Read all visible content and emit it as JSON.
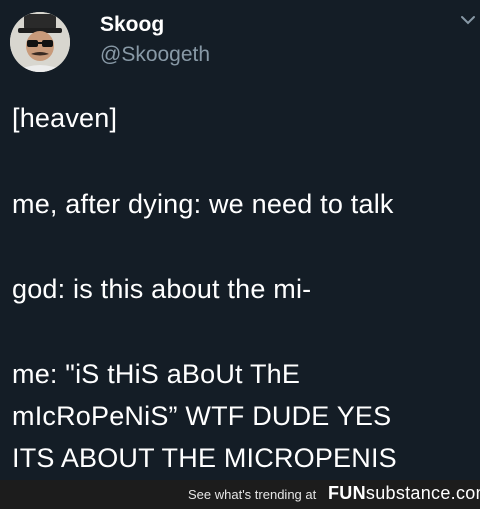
{
  "tweet": {
    "author_name": "Skoog",
    "author_handle": "@Skoogeth",
    "lines": [
      "[heaven]",
      "me, after dying: we need to talk",
      "god: is this about the mi-",
      "me: \"iS tHiS aBoUt ThE",
      "mIcRoPeNiS” WTF DUDE YES",
      "ITS ABOUT THE MICROPENIS"
    ]
  },
  "footer": {
    "trending_text": "See what's trending at",
    "brand_fun": "FUN",
    "brand_rest": "substance.com"
  },
  "colors": {
    "background": "#141d26",
    "handle": "#8899a6",
    "footer_bg": "#1c1c1c"
  },
  "icons": [
    "avatar-image",
    "chevron-down-icon"
  ]
}
